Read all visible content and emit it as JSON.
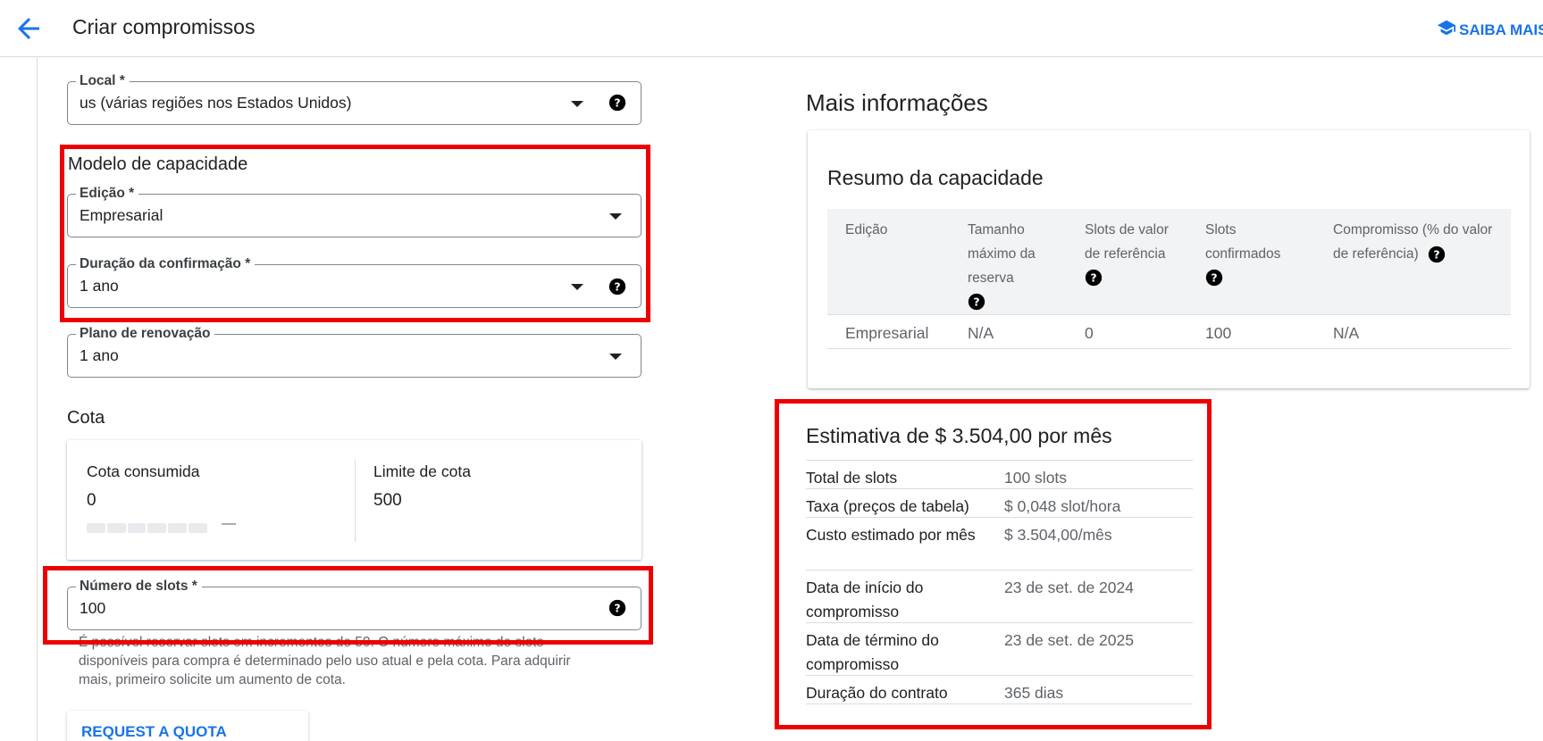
{
  "header": {
    "title": "Criar compromissos",
    "learn_more": "SAIBA MAIS"
  },
  "form": {
    "location": {
      "label": "Local *",
      "value": "us (várias regiões nos Estados Unidos)"
    },
    "capacity_model": {
      "heading": "Modelo de capacidade",
      "edition": {
        "label": "Edição *",
        "value": "Empresarial"
      },
      "commitment_duration": {
        "label": "Duração da confirmação *",
        "value": "1 ano"
      }
    },
    "renewal_plan": {
      "label": "Plano de renovação",
      "value": "1 ano"
    },
    "quota": {
      "heading": "Cota",
      "consumed_label": "Cota consumida",
      "consumed_value": "0",
      "consumed_fraction": 0,
      "consumed_dash": "—",
      "limit_label": "Limite de cota",
      "limit_value": "500"
    },
    "slots": {
      "label": "Número de slots *",
      "value": "100",
      "hint": "É possível reservar slots em incrementos de 50. O número máximo de slots disponíveis para compra é determinado pelo uso atual e pela cota. Para adquirir mais, primeiro solicite um aumento de cota."
    },
    "quota_button": "REQUEST A QUOTA INCREASE"
  },
  "info": {
    "title": "Mais informações",
    "capacity_summary": {
      "title": "Resumo da capacidade",
      "columns": [
        "Edição",
        "Tamanho máximo da reserva",
        "Slots de valor de referência",
        "Slots confirmados",
        "Compromisso (% do valor de referência)"
      ],
      "row": [
        "Empresarial",
        "N/A",
        "0",
        "100",
        "N/A"
      ]
    },
    "estimate": {
      "title": "Estimativa de $ 3.504,00 por mês",
      "rows": [
        {
          "key": "Total de slots",
          "value": "100 slots"
        },
        {
          "key": "Taxa (preços de tabela)",
          "value": "$ 0,048 slot/hora"
        },
        {
          "key": "Custo estimado por mês",
          "value": "$ 3.504,00/mês"
        },
        {
          "key": "Data de início do compromisso",
          "value": "23 de set. de 2024"
        },
        {
          "key": "Data de término do compromisso",
          "value": "23 de set. de 2025"
        },
        {
          "key": "Duração do contrato",
          "value": "365 dias"
        }
      ]
    }
  },
  "colors": {
    "accent": "#1a73e8",
    "highlight": "#ee0000",
    "text": "#202124",
    "muted": "#5f6368"
  }
}
